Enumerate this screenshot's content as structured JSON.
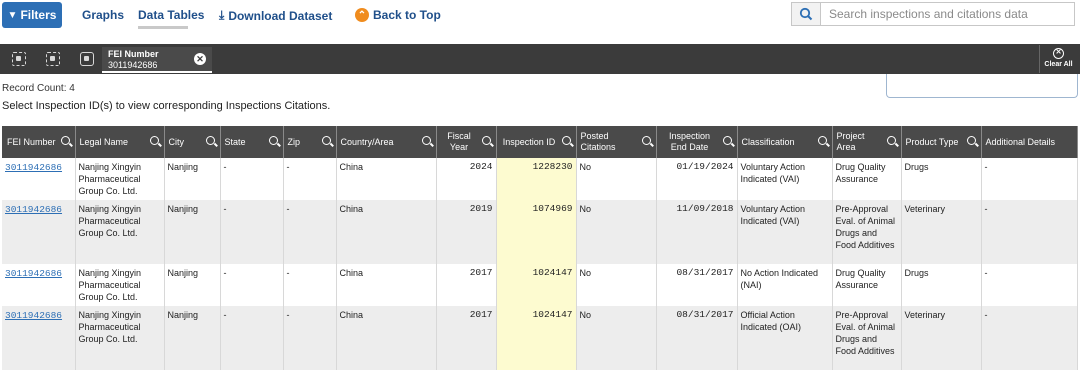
{
  "nav": {
    "filters_label": "Filters",
    "graphs_label": "Graphs",
    "tables_label": "Data Tables",
    "download_label": "Download Dataset",
    "top_label": "Back to Top"
  },
  "search": {
    "placeholder": "Search inspections and citations data",
    "value": ""
  },
  "filter_bar": {
    "chip_label": "FEI Number",
    "chip_value": "3011942686",
    "clear_label": "Clear All"
  },
  "record_count": "Record Count: 4",
  "instructions": "Select Inspection ID(s) to view corresponding Inspections Citations.",
  "table": {
    "columns": [
      {
        "label": "FEI Number"
      },
      {
        "label": "Legal Name"
      },
      {
        "label": "City"
      },
      {
        "label": "State"
      },
      {
        "label": "Zip"
      },
      {
        "label": "Country/Area"
      },
      {
        "label": "Fiscal Year"
      },
      {
        "label": "Inspection ID"
      },
      {
        "label": "Posted Citations"
      },
      {
        "label": "Inspection End Date"
      },
      {
        "label": "Classification"
      },
      {
        "label": "Project Area"
      },
      {
        "label": "Product Type"
      },
      {
        "label": "Additional Details"
      }
    ],
    "rows": [
      {
        "fei": "3011942686",
        "name": "Nanjing Xingyin Pharmaceutical Group Co. Ltd.",
        "city": "Nanjing",
        "state": "-",
        "zip": "-",
        "country": "China",
        "year": "2024",
        "insp_id": "1228230",
        "posted": "No",
        "end_date": "01/19/2024",
        "classification": "Voluntary Action Indicated (VAI)",
        "project": "Drug Quality Assurance",
        "product": "Drugs",
        "details": "-"
      },
      {
        "fei": "3011942686",
        "name": "Nanjing Xingyin Pharmaceutical Group Co. Ltd.",
        "city": "Nanjing",
        "state": "-",
        "zip": "-",
        "country": "China",
        "year": "2019",
        "insp_id": "1074969",
        "posted": "No",
        "end_date": "11/09/2018",
        "classification": "Voluntary Action Indicated (VAI)",
        "project": "Pre-Approval Eval. of Animal Drugs and Food Additives",
        "product": "Veterinary",
        "details": "-"
      },
      {
        "fei": "3011942686",
        "name": "Nanjing Xingyin Pharmaceutical Group Co. Ltd.",
        "city": "Nanjing",
        "state": "-",
        "zip": "-",
        "country": "China",
        "year": "2017",
        "insp_id": "1024147",
        "posted": "No",
        "end_date": "08/31/2017",
        "classification": "No Action Indicated (NAI)",
        "project": "Drug Quality Assurance",
        "product": "Drugs",
        "details": "-"
      },
      {
        "fei": "3011942686",
        "name": "Nanjing Xingyin Pharmaceutical Group Co. Ltd.",
        "city": "Nanjing",
        "state": "-",
        "zip": "-",
        "country": "China",
        "year": "2017",
        "insp_id": "1024147",
        "posted": "No",
        "end_date": "08/31/2017",
        "classification": "Official Action Indicated (OAI)",
        "project": "Pre-Approval Eval. of Animal Drugs and Food Additives",
        "product": "Veterinary",
        "details": "-"
      }
    ]
  },
  "colors": {
    "primary": "#2d6fb5",
    "header_bg": "#4a4a4a",
    "filterbar_bg": "#3b3b3b",
    "highlight": "#fdfbd0",
    "accent_orange": "#f08c1e"
  }
}
